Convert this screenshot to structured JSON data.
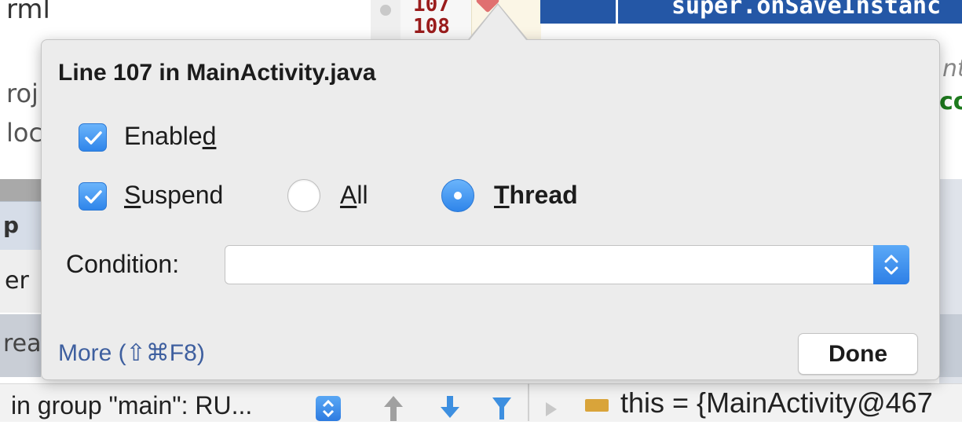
{
  "background": {
    "left_fragments": [
      "rml",
      "roj",
      "loc",
      "p",
      "er",
      "rea"
    ],
    "line_numbers": [
      "107",
      "108"
    ],
    "code_line": "super.onSaveInstanc",
    "right_fragments": [
      "nt",
      "co"
    ],
    "status_text": "in group \"main\": RU...",
    "variable_text": "this = {MainActivity@467"
  },
  "popup": {
    "title": "Line 107 in MainActivity.java",
    "enabled_label": "Enabled",
    "enabled_checked": true,
    "suspend_label": "Suspend",
    "suspend_checked": true,
    "suspend_all_label": "All",
    "suspend_thread_label": "Thread",
    "suspend_policy": "Thread",
    "condition_label": "Condition:",
    "condition_value": "",
    "more_link": "More (⇧⌘F8)",
    "done_label": "Done"
  },
  "colors": {
    "accent": "#2f85ea",
    "link": "#3e5f9f",
    "code_highlight": "#2457a6",
    "line_number": "#9a1c1c"
  }
}
